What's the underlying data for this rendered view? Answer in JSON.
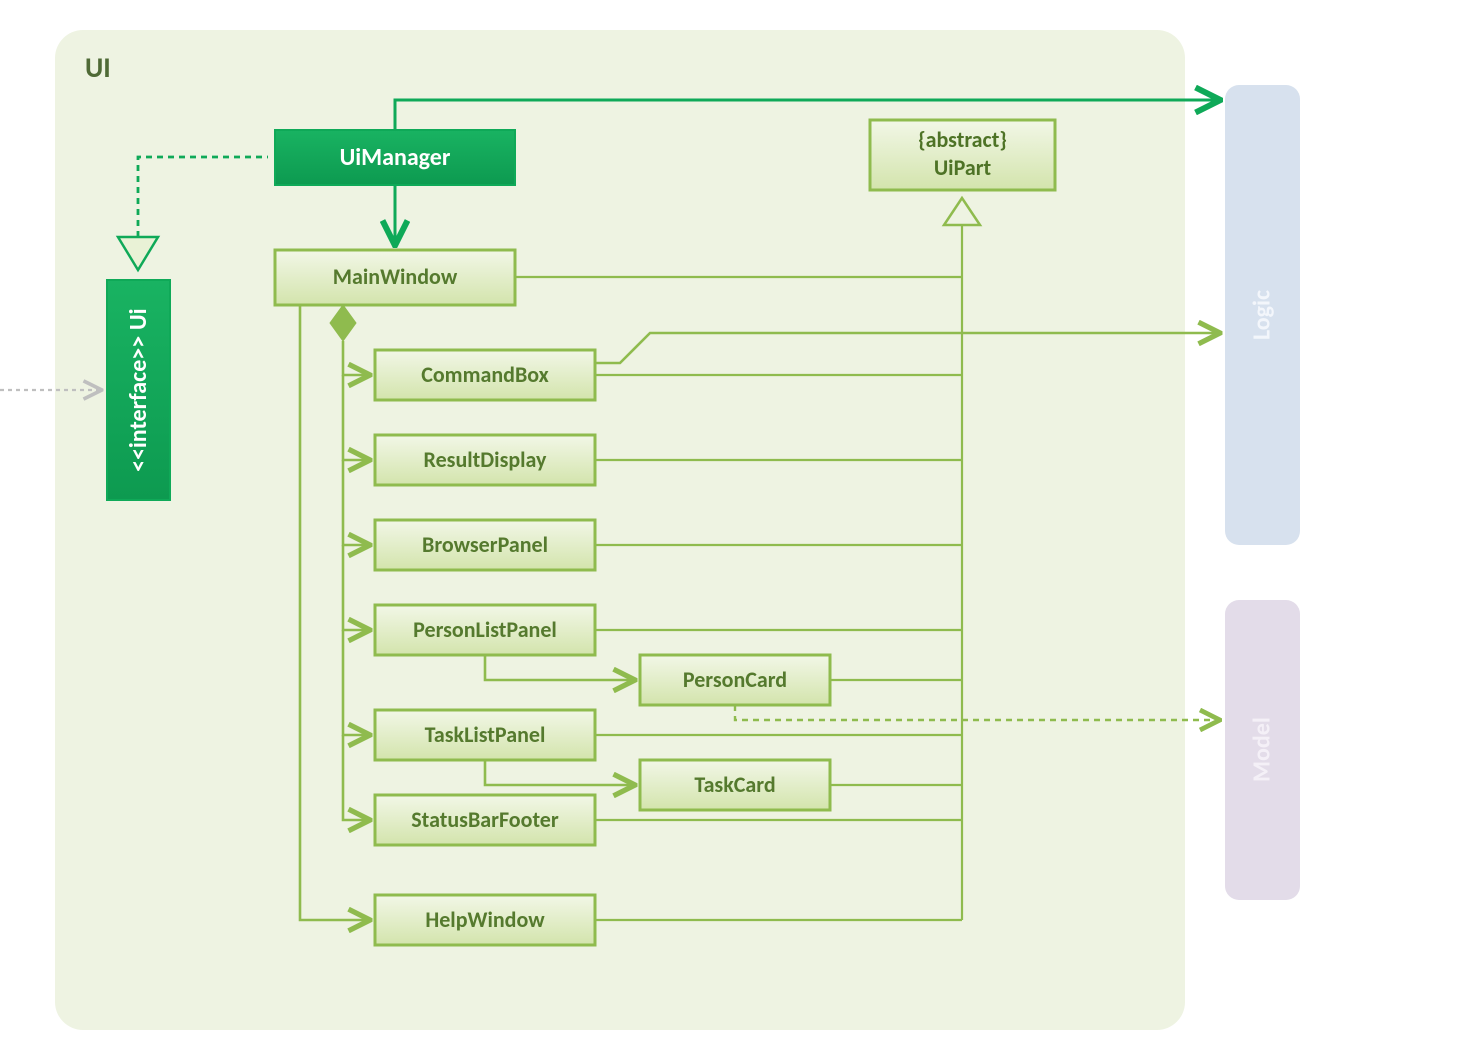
{
  "package": {
    "name": "UI"
  },
  "interface": {
    "stereotype": "<<interface>>",
    "name": "Ui"
  },
  "classes": {
    "uiManager": "UiManager",
    "mainWindow": "MainWindow",
    "commandBox": "CommandBox",
    "resultDisplay": "ResultDisplay",
    "browserPanel": "BrowserPanel",
    "personListPanel": "PersonListPanel",
    "personCard": "PersonCard",
    "taskListPanel": "TaskListPanel",
    "taskCard": "TaskCard",
    "statusBarFooter": "StatusBarFooter",
    "helpWindow": "HelpWindow",
    "uiPart": {
      "stereotype": "{abstract}",
      "name": "UiPart"
    }
  },
  "external": {
    "logic": "Logic",
    "model": "Model"
  },
  "colors": {
    "pkgFill": "#eef3e2",
    "darkGreen": "#0fa958",
    "darkGreenFill": "#14ad5d",
    "lightGreenStroke": "#8fbb4e",
    "lightGreenFillTop": "#ecf4dc",
    "lightGreenFillBot": "#d5e6b0",
    "logicFill": "#d7e1ee",
    "modelFill": "#e3dce9",
    "arrowGreen": "#0fa958",
    "arrowOlive": "#8fbb4e",
    "gray": "#bfbfbf"
  }
}
